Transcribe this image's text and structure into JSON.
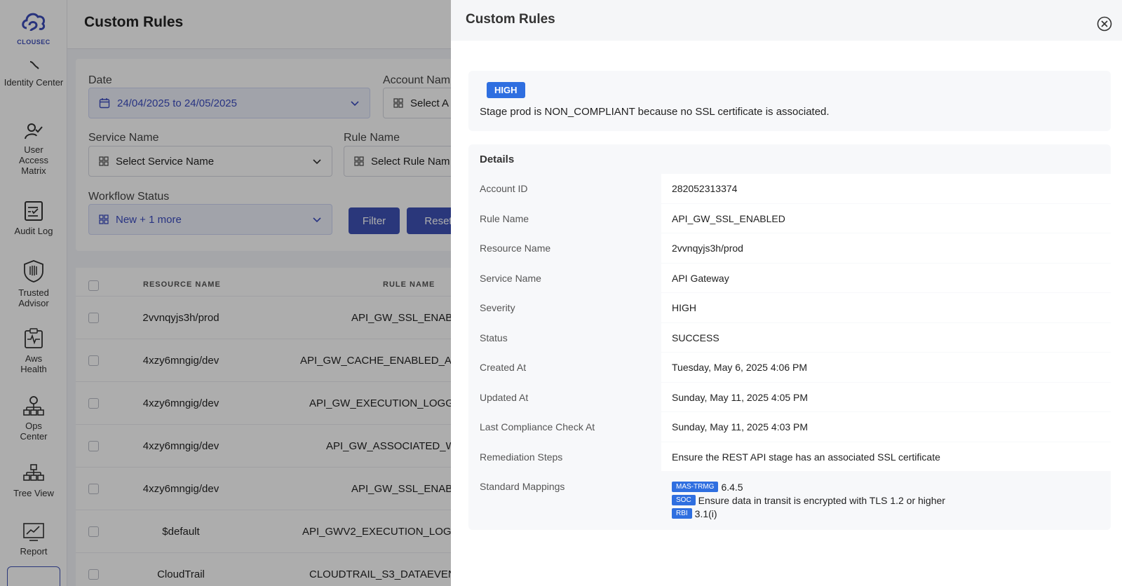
{
  "sidebar": {
    "logo_text": "CLOUSEC",
    "items": [
      {
        "label": "Identity Center",
        "icon": "key-icon"
      },
      {
        "label": "User Access Matrix",
        "icon": "user-check-icon"
      },
      {
        "label": "Audit Log",
        "icon": "checklist-icon"
      },
      {
        "label": "Trusted Advisor",
        "icon": "shield-icon"
      },
      {
        "label": "Aws Health",
        "icon": "health-clipboard-icon"
      },
      {
        "label": "Ops Center",
        "icon": "network-gear-icon"
      },
      {
        "label": "Tree View",
        "icon": "hierarchy-icon"
      },
      {
        "label": "Report",
        "icon": "chart-monitor-icon"
      }
    ]
  },
  "page": {
    "title": "Custom Rules",
    "filters": {
      "date_label": "Date",
      "date_value": "24/04/2025 to 24/05/2025",
      "account_label": "Account Nam",
      "account_placeholder": "Select A",
      "service_label": "Service Name",
      "service_placeholder": "Select Service Name",
      "rule_label": "Rule Name",
      "rule_placeholder": "Select Rule Nam",
      "workflow_label": "Workflow Status",
      "workflow_value": "New + 1 more",
      "filter_button": "Filter",
      "reset_button": "Reset"
    },
    "table": {
      "headers": [
        "RESOURCE NAME",
        "RULE NAME"
      ],
      "rows": [
        {
          "resource": "2vvnqyjs3h/prod",
          "rule": "API_GW_SSL_ENABL"
        },
        {
          "resource": "4xzy6mngig/dev",
          "rule": "API_GW_CACHE_ENABLED_AND"
        },
        {
          "resource": "4xzy6mngig/dev",
          "rule": "API_GW_EXECUTION_LOGGIN"
        },
        {
          "resource": "4xzy6mngig/dev",
          "rule": "API_GW_ASSOCIATED_WI"
        },
        {
          "resource": "4xzy6mngig/dev",
          "rule": "API_GW_SSL_ENABL"
        },
        {
          "resource": "$default",
          "rule": "API_GWV2_EXECUTION_LOGGI"
        },
        {
          "resource": "CloudTrail",
          "rule": "CLOUDTRAIL_S3_DATAEVENT"
        }
      ]
    }
  },
  "drawer": {
    "title": "Custom Rules",
    "severity_badge": "HIGH",
    "finding_text": "Stage prod is NON_COMPLIANT because no SSL certificate is associated.",
    "details_title": "Details",
    "details": [
      {
        "key": "Account ID",
        "value": "282052313374"
      },
      {
        "key": "Rule Name",
        "value": "API_GW_SSL_ENABLED"
      },
      {
        "key": "Resource Name",
        "value": "2vvnqyjs3h/prod"
      },
      {
        "key": "Service Name",
        "value": "API Gateway"
      },
      {
        "key": "Severity",
        "value": "HIGH"
      },
      {
        "key": "Status",
        "value": "SUCCESS"
      },
      {
        "key": "Created At",
        "value": "Tuesday, May 6, 2025 4:06 PM"
      },
      {
        "key": "Updated At",
        "value": "Sunday, May 11, 2025 4:05 PM"
      },
      {
        "key": "Last Compliance Check At",
        "value": "Sunday, May 11, 2025 4:03 PM"
      },
      {
        "key": "Remediation Steps",
        "value": "Ensure the REST API stage has an associated SSL certificate"
      }
    ],
    "mappings_key": "Standard Mappings",
    "mappings": [
      {
        "tag": "MAS-TRMG",
        "text": "6.4.5"
      },
      {
        "tag": "SOC",
        "text": "Ensure data in transit is encrypted with TLS 1.2 or higher"
      },
      {
        "tag": "RBI",
        "text": "3.1(i)"
      }
    ]
  },
  "colors": {
    "accent": "#3f51b5",
    "badge_blue": "#2f6fe0",
    "overlay": "rgba(0,0,0,0.32)"
  }
}
